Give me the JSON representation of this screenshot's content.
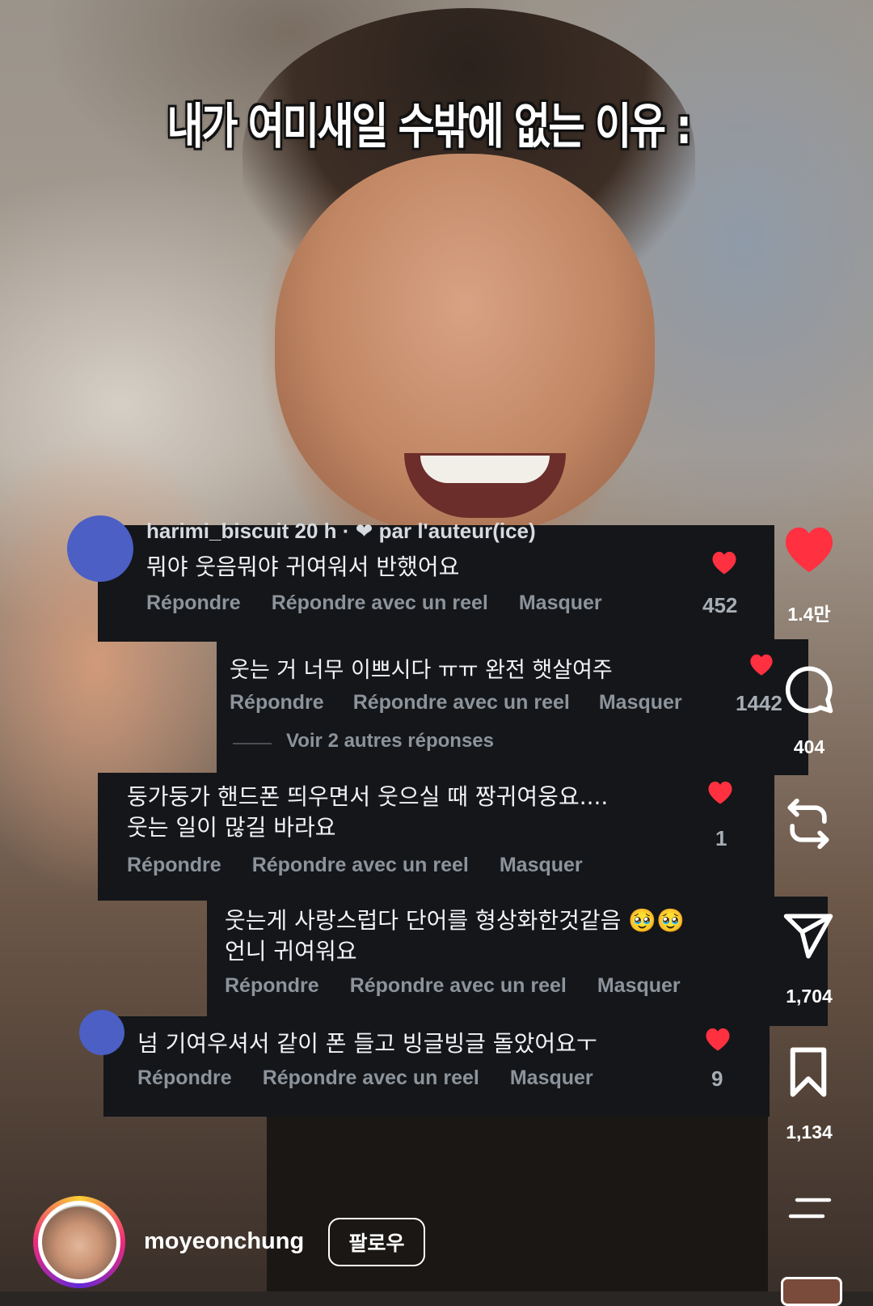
{
  "video": {
    "caption": "내가 여미새일 수밖에 없는 이유 :"
  },
  "comments": [
    {
      "meta": "harimi_biscuit 20 h · ❤ par l'auteur(ice)",
      "text": "뭐야 웃음뭐야  귀여워서 반했어요",
      "reply_label": "Répondre",
      "reel_label": "Répondre avec un reel",
      "hide_label": "Masquer",
      "likes": "452"
    },
    {
      "text": "웃는 거 너무 이쁘시다 ㅠㅠ 완전 햇살여주",
      "reply_label": "Répondre",
      "reel_label": "Répondre avec un reel",
      "hide_label": "Masquer",
      "likes": "1442",
      "more_replies": "Voir 2 autres réponses"
    },
    {
      "text_line1": "둥가둥가 핸드폰 띄우면서 웃으실 때 짱귀여웅요....",
      "text_line2": "웃는 일이 많길 바라요",
      "reply_label": "Répondre",
      "reel_label": "Répondre avec un reel",
      "hide_label": "Masquer",
      "likes": "1"
    },
    {
      "text_line1": "웃는게 사랑스럽다 단어를 형상화한것같음 🥹🥹",
      "text_line2": "언니 귀여워요",
      "reply_label": "Répondre",
      "reel_label": "Répondre avec un reel",
      "hide_label": "Masquer"
    },
    {
      "text": "넘 기여우셔서 같이 폰 들고 빙글빙글 돌았어요ㅜ",
      "reply_label": "Répondre",
      "reel_label": "Répondre avec un reel",
      "hide_label": "Masquer",
      "likes": "9"
    }
  ],
  "rail": {
    "like_count": "1.4만",
    "comment_count": "404",
    "repost_count": "1,704",
    "save_count": "1,134",
    "like_color": "#ff3040"
  },
  "footer": {
    "username": "moyeonchung",
    "follow_label": "팔로우"
  },
  "colors": {
    "card_bg": "#141619",
    "heart_red": "#ff3040"
  }
}
